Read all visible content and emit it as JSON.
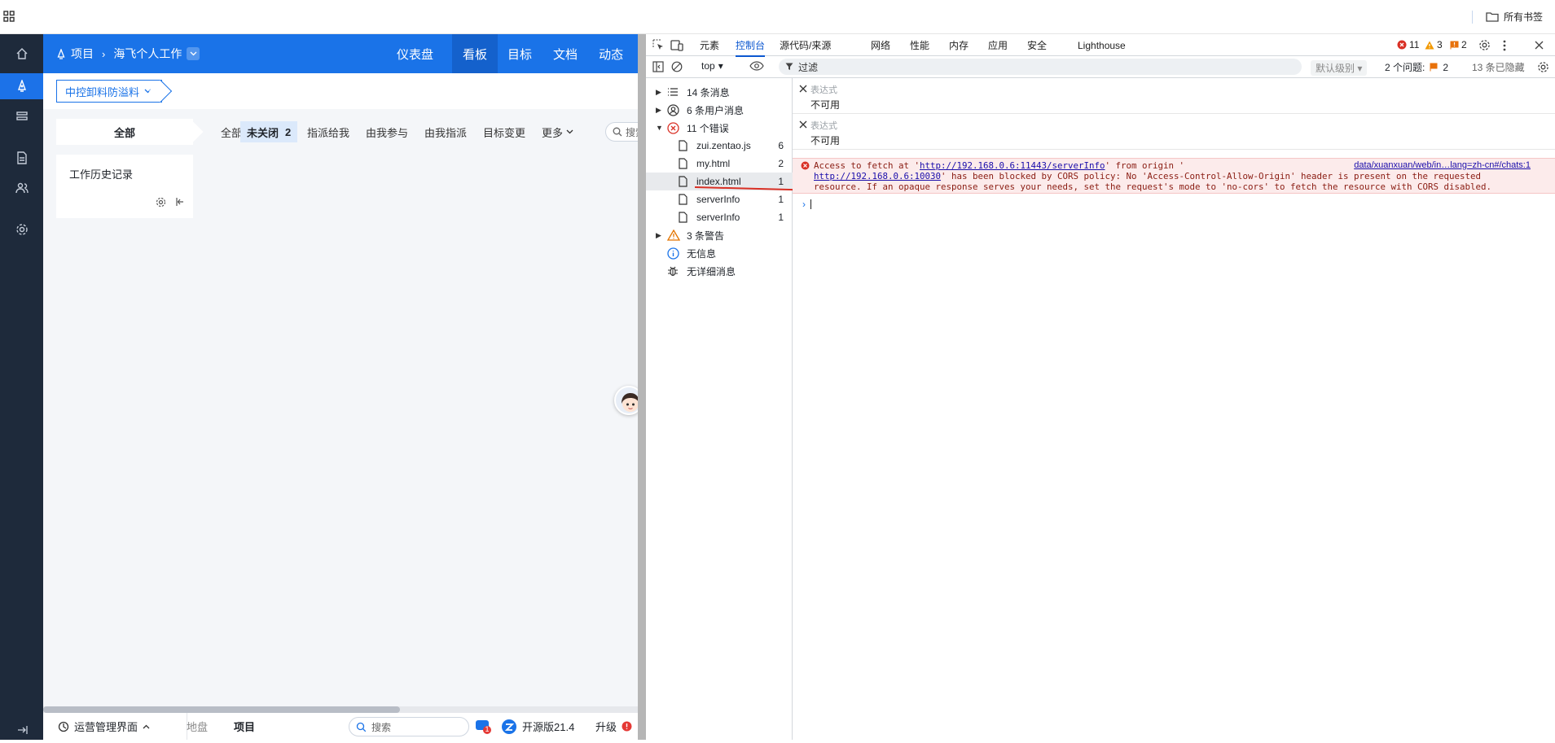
{
  "browser": {
    "all_bookmarks": "所有书签"
  },
  "app": {
    "breadcrumb": {
      "root": "项目",
      "current": "海飞个人工作"
    },
    "nav": [
      "仪表盘",
      "看板",
      "目标",
      "文档",
      "动态"
    ],
    "nav_active": "看板",
    "product_select": "中控卸料防溢料",
    "all_card": "全部",
    "filter_tabs": [
      {
        "label": "全部"
      },
      {
        "label": "未关闭",
        "count": "2"
      },
      {
        "label": "指派给我"
      },
      {
        "label": "由我参与"
      },
      {
        "label": "由我指派"
      },
      {
        "label": "目标变更"
      },
      {
        "label": "更多"
      }
    ],
    "filter_search": "搜索",
    "history_card_title": "工作历史记录",
    "bottom": {
      "ops": "运营管理界面",
      "disk": "地盘",
      "project": "项目",
      "search": "搜索",
      "badge": "1",
      "version": "开源版21.4",
      "upgrade": "升级"
    }
  },
  "devtools": {
    "tabs": [
      "元素",
      "控制台",
      "源代码/来源",
      "网络",
      "性能",
      "内存",
      "应用",
      "安全",
      "Lighthouse"
    ],
    "active_tab": "控制台",
    "counts": {
      "errors": "11",
      "warnings": "3",
      "issues": "2"
    },
    "context": "top",
    "filter_placeholder": "过滤",
    "level": "默认级别",
    "issues_label": "2 个问题:",
    "issues_count": "2",
    "hidden": "13 条已隐藏",
    "sidebar": {
      "messages": "14 条消息",
      "user_messages": "6 条用户消息",
      "errors": "11 个错误",
      "files": [
        {
          "name": "zui.zentao.js",
          "count": "6"
        },
        {
          "name": "my.html",
          "count": "2"
        },
        {
          "name": "index.html",
          "count": "1"
        },
        {
          "name": "serverInfo",
          "count": "1"
        },
        {
          "name": "serverInfo",
          "count": "1"
        }
      ],
      "warnings": "3 条警告",
      "info": "无信息",
      "verbose": "无详细消息"
    },
    "expressions": [
      {
        "placeholder": "表达式",
        "value": "不可用"
      },
      {
        "placeholder": "表达式",
        "value": "不可用"
      }
    ],
    "error": {
      "part1": "Access to fetch at '",
      "url1": "http://192.168.0.6:11443/serverInfo",
      "part2": "' from origin '",
      "url2": "http://192.168.0.6:10030",
      "part3": "' has been blocked by CORS policy: No 'Access-Control-Allow-Origin' header is present on the requested",
      "line3": "resource. If an opaque response serves your needs, set the request's mode to 'no-cors' to fetch the resource with CORS disabled.",
      "source": "data/xuanxuan/web/in…lang=zh-cn#/chats:1"
    }
  },
  "colors": {
    "accent": "#1a73e8",
    "sidebar_bg": "#1e2a3b",
    "error_bg": "#fcebeb",
    "error_text": "#8a1c12"
  }
}
